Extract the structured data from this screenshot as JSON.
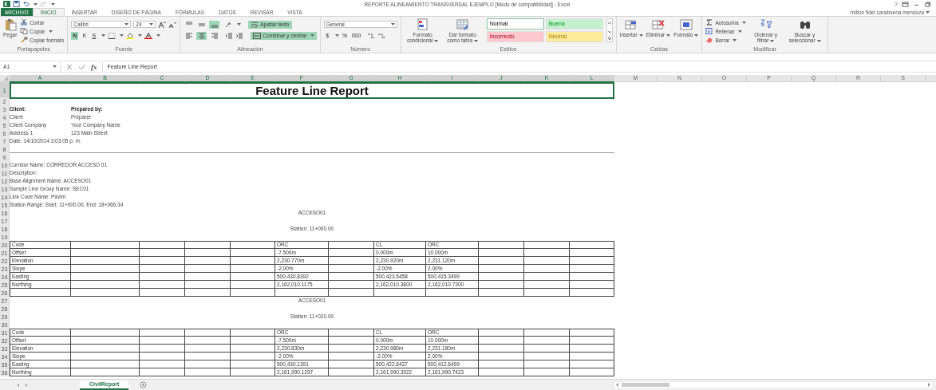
{
  "window": {
    "title": "REPORTE ALINEAMIENTO TRANSVERSAL EJEMPLO  [Modo de compatibilidad] - Excel",
    "help": "?",
    "user": "milton fidel carabuena mendoza"
  },
  "tabs": [
    {
      "label": "ARCHIVO",
      "kind": "file",
      "selected": false
    },
    {
      "label": "INICIO",
      "kind": "tab",
      "selected": true
    },
    {
      "label": "INSERTAR",
      "kind": "tab",
      "selected": false
    },
    {
      "label": "DISEÑO DE PÁGINA",
      "kind": "tab",
      "selected": false
    },
    {
      "label": "FÓRMULAS",
      "kind": "tab",
      "selected": false
    },
    {
      "label": "DATOS",
      "kind": "tab",
      "selected": false
    },
    {
      "label": "REVISAR",
      "kind": "tab",
      "selected": false
    },
    {
      "label": "VISTA",
      "kind": "tab",
      "selected": false
    }
  ],
  "ribbon": {
    "clipboard": {
      "label": "Portapapeles",
      "paste": "Pegar",
      "cut": "Cortar",
      "copy": "Copiar",
      "format_painter": "Copiar formato"
    },
    "font": {
      "label": "Fuente",
      "font_name": "Calibri",
      "font_size": "24",
      "bold": {
        "text": "N",
        "on": true
      },
      "italic": {
        "text": "K",
        "on": false
      },
      "underline": {
        "text": "S",
        "on": false
      }
    },
    "alignment": {
      "label": "Alineación",
      "vertical": [
        {
          "selected": false
        },
        {
          "selected": false
        },
        {
          "selected": true
        }
      ],
      "horizontal": [
        {
          "selected": false
        },
        {
          "selected": true
        },
        {
          "selected": false
        }
      ],
      "wrap_text": {
        "text": "Ajustar texto",
        "on": true
      },
      "merge": {
        "text": "Combinar y centrar",
        "on": true
      }
    },
    "number": {
      "label": "Número",
      "format": "General",
      "currency": "$",
      "percent": "%",
      "thousands": "000"
    },
    "styles": {
      "label": "Estilos",
      "conditional": "Formato condicional",
      "as_table": "Dar formato como tabla",
      "cells": [
        {
          "text": "Normal",
          "color": "#ffffff",
          "selected": true
        },
        {
          "text": "Buena",
          "color": "#c6efce",
          "selected": false
        },
        {
          "text": "Incorrecto",
          "color": "#ffc7ce",
          "selected": false
        },
        {
          "text": "Neutral",
          "color": "#ffeb9c",
          "selected": false
        }
      ]
    },
    "cells": {
      "label": "Celdas",
      "insert": "Insertar",
      "delete": "Eliminar",
      "format": "Formato"
    },
    "editing": {
      "label": "Modificar",
      "autosum": "Autosuma",
      "fill": "Rellenar",
      "clear": "Borrar",
      "sort": "Ordenar y filtrar",
      "find": "Buscar y seleccionar"
    }
  },
  "formula_bar": {
    "name_box": "A1",
    "fx": "fx",
    "formula": "Feature Line Report"
  },
  "columns": [
    {
      "label": "A",
      "selected": true
    },
    {
      "label": "B",
      "selected": true
    },
    {
      "label": "C",
      "selected": true
    },
    {
      "label": "D",
      "selected": true
    },
    {
      "label": "E",
      "selected": true
    },
    {
      "label": "F",
      "selected": true
    },
    {
      "label": "G",
      "selected": true
    },
    {
      "label": "H",
      "selected": true
    },
    {
      "label": "I",
      "selected": true
    },
    {
      "label": "J",
      "selected": true
    },
    {
      "label": "K",
      "selected": true
    },
    {
      "label": "L",
      "selected": true
    },
    {
      "label": "M",
      "selected": false
    },
    {
      "label": "N",
      "selected": false
    },
    {
      "label": "O",
      "selected": false
    },
    {
      "label": "P",
      "selected": false
    },
    {
      "label": "Q",
      "selected": false
    },
    {
      "label": "R",
      "selected": false
    },
    {
      "label": "S",
      "selected": false
    }
  ],
  "rows": [
    {
      "number": "1",
      "kind": "title",
      "text": "Feature Line Report",
      "selected": true
    },
    {
      "number": "2",
      "kind": "blank"
    },
    {
      "number": "3",
      "kind": "info",
      "bold": true,
      "cells": [
        "Client:",
        "Prepared by:"
      ]
    },
    {
      "number": "4",
      "kind": "info",
      "bold": false,
      "cells": [
        "Client",
        "Preparer"
      ]
    },
    {
      "number": "5",
      "kind": "info",
      "bold": false,
      "cells": [
        "Client Company",
        "Your Company Name"
      ]
    },
    {
      "number": "6",
      "kind": "info",
      "bold": false,
      "cells": [
        "Address 1",
        "123 Main Street"
      ]
    },
    {
      "number": "7",
      "kind": "info",
      "bold": false,
      "cells": [
        "Date: 14/10/2014 3:03:05 p. m."
      ]
    },
    {
      "number": "8",
      "kind": "rule"
    },
    {
      "number": "9",
      "kind": "blank"
    },
    {
      "number": "10",
      "kind": "info",
      "bold": false,
      "cells": [
        "Corridor Name: CORREDOR ACCESO 01"
      ]
    },
    {
      "number": "11",
      "kind": "info",
      "bold": false,
      "cells": [
        "Description:"
      ]
    },
    {
      "number": "12",
      "kind": "info",
      "bold": false,
      "cells": [
        "Base Alignment Name: ACCESO01"
      ]
    },
    {
      "number": "13",
      "kind": "info",
      "bold": false,
      "cells": [
        "Sample Line Group Name: SEC01"
      ]
    },
    {
      "number": "14",
      "kind": "info",
      "bold": false,
      "cells": [
        "Link Code Name: Pavim"
      ]
    },
    {
      "number": "15",
      "kind": "info",
      "bold": false,
      "cells": [
        "Station Range: Start: 11+000.00, End: 18+066.34"
      ]
    },
    {
      "number": "16",
      "kind": "center",
      "text": "ACCESO01"
    },
    {
      "number": "17",
      "kind": "blank"
    },
    {
      "number": "18",
      "kind": "center",
      "text": "Station: 11+000.00"
    },
    {
      "number": "19",
      "kind": "blank"
    },
    {
      "number": "20",
      "kind": "table",
      "cells": [
        "Code",
        null,
        null,
        null,
        null,
        "ORC",
        null,
        "CL",
        "ORC",
        null,
        null,
        null
      ]
    },
    {
      "number": "21",
      "kind": "table",
      "cells": [
        "Offset",
        null,
        null,
        null,
        null,
        "-7.500m",
        null,
        "0.000m",
        "10.000m",
        null,
        null,
        null
      ]
    },
    {
      "number": "22",
      "kind": "table",
      "cells": [
        "Elevation",
        null,
        null,
        null,
        null,
        "2,230.770m",
        null,
        "2,230.920m",
        "2,231.120m",
        null,
        null,
        null
      ]
    },
    {
      "number": "23",
      "kind": "table",
      "cells": [
        "Slope",
        null,
        null,
        null,
        null,
        "-2.00%",
        null,
        "-2.00%",
        "2.00%",
        null,
        null,
        null
      ]
    },
    {
      "number": "24",
      "kind": "table",
      "cells": [
        "Easting",
        null,
        null,
        null,
        null,
        "500,430.8392",
        null,
        "500,423.5458",
        "500,415.3499",
        null,
        null,
        null
      ]
    },
    {
      "number": "25",
      "kind": "table",
      "cells": [
        "Northing",
        null,
        null,
        null,
        null,
        "2,162,010.1175",
        null,
        "2,162,010.3800",
        "2,162,010.7300",
        null,
        null,
        null
      ]
    },
    {
      "number": "26",
      "kind": "table",
      "cells": [
        null,
        null,
        null,
        null,
        null,
        null,
        null,
        null,
        null,
        null,
        null,
        null
      ]
    },
    {
      "number": "27",
      "kind": "center",
      "text": "ACCESO01"
    },
    {
      "number": "28",
      "kind": "blank"
    },
    {
      "number": "29",
      "kind": "center",
      "text": "Station: 11+020.00"
    },
    {
      "number": "30",
      "kind": "blank"
    },
    {
      "number": "31",
      "kind": "table",
      "cells": [
        "Code",
        null,
        null,
        null,
        null,
        "ORC",
        null,
        "CL",
        "ORC",
        null,
        null,
        null
      ]
    },
    {
      "number": "32",
      "kind": "table",
      "cells": [
        "Offset",
        null,
        null,
        null,
        null,
        "-7.500m",
        null,
        "0.000m",
        "10.000m",
        null,
        null,
        null
      ]
    },
    {
      "number": "33",
      "kind": "table",
      "cells": [
        "Elevation",
        null,
        null,
        null,
        null,
        "2,230.830m",
        null,
        "2,230.980m",
        "2,231.180m",
        null,
        null,
        null
      ]
    },
    {
      "number": "34",
      "kind": "table",
      "cells": [
        "Slope",
        null,
        null,
        null,
        null,
        "-2.00%",
        null,
        "-2.00%",
        "2.00%",
        null,
        null,
        null
      ]
    },
    {
      "number": "35",
      "kind": "table",
      "cells": [
        "Easting",
        null,
        null,
        null,
        null,
        "500,430.1391",
        null,
        "500,422.6437",
        "500,412.6499",
        null,
        null,
        null
      ]
    },
    {
      "number": "36",
      "kind": "table",
      "cells": [
        "Northing",
        null,
        null,
        null,
        null,
        "2,161,990.1297",
        null,
        "2,161,990.3922",
        "2,161,990.7423",
        null,
        null,
        null
      ]
    }
  ],
  "sheet_tabs": [
    {
      "label": "CivilReport",
      "selected": true
    }
  ]
}
